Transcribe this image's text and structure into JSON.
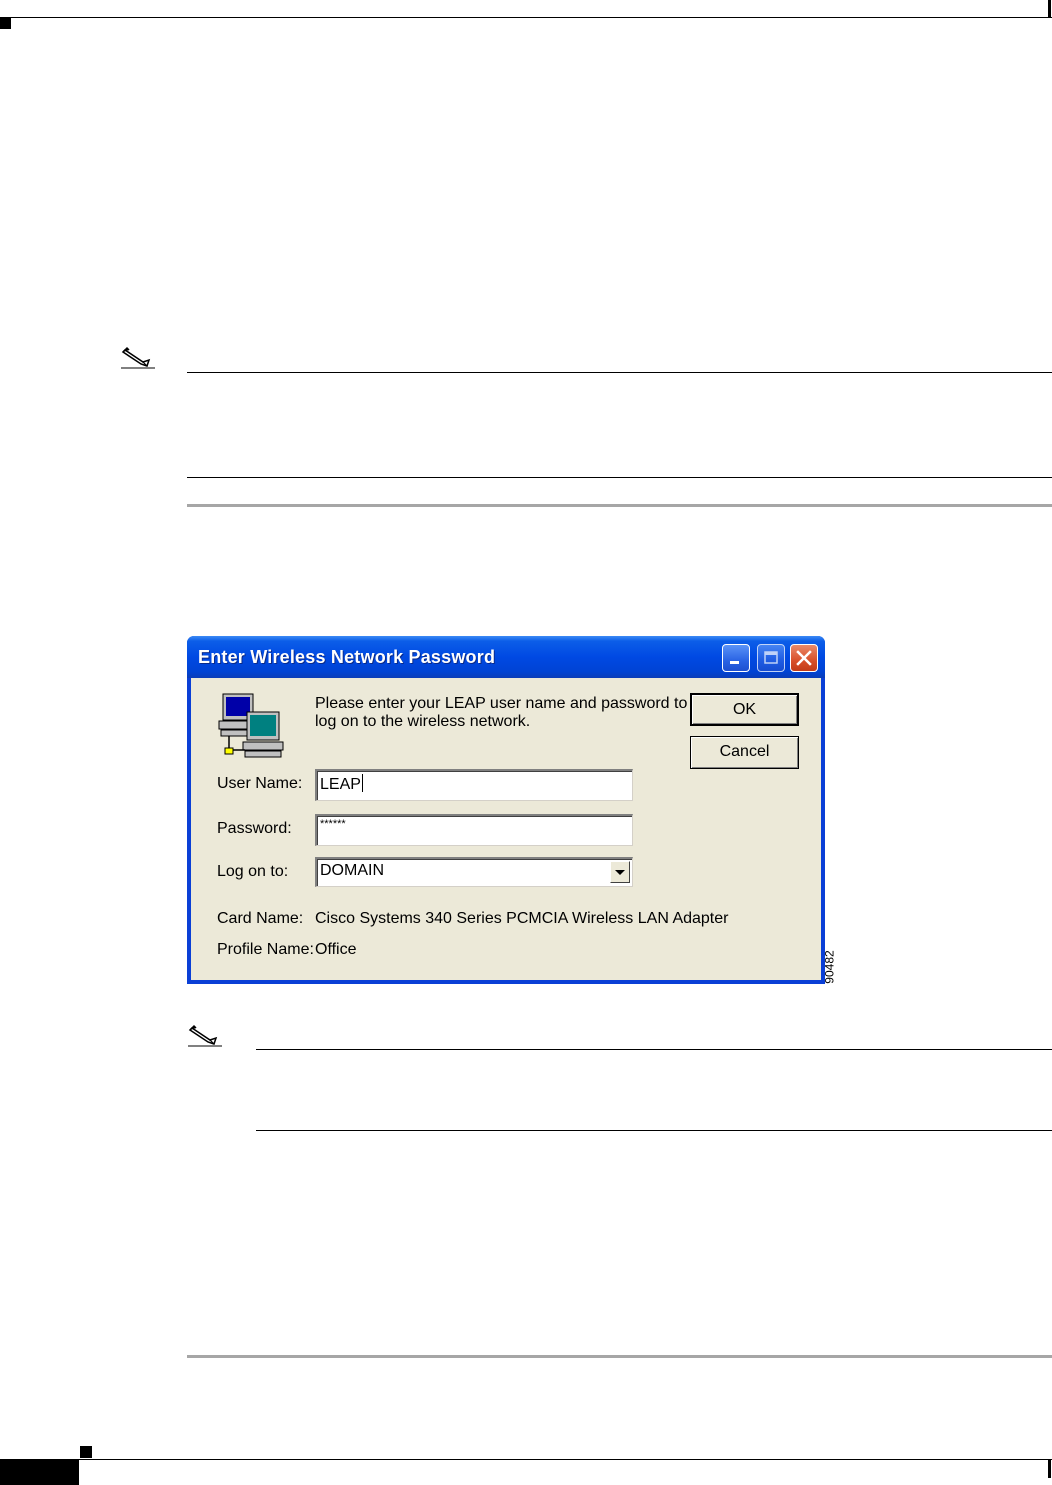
{
  "dialog": {
    "title": "Enter Wireless Network Password",
    "message_line1": "Please enter your LEAP user name and password to",
    "message_line2": "log on to the wireless network.",
    "ok_label": "OK",
    "cancel_label": "Cancel",
    "username_label": "User Name:",
    "username_value": "LEAP",
    "password_label": "Password:",
    "password_value": "******",
    "logon_label": "Log on to:",
    "logon_value": "DOMAIN",
    "card_name_label": "Card Name:",
    "card_name_value": "Cisco Systems 340 Series PCMCIA Wireless LAN Adapter",
    "profile_name_label": "Profile Name:",
    "profile_name_value": "Office"
  },
  "figure": {
    "id": "90482"
  },
  "icons": [
    "note-pencil-icon",
    "network-computers-icon",
    "minimize-icon",
    "maximize-icon",
    "close-icon",
    "dropdown-arrow-icon"
  ]
}
